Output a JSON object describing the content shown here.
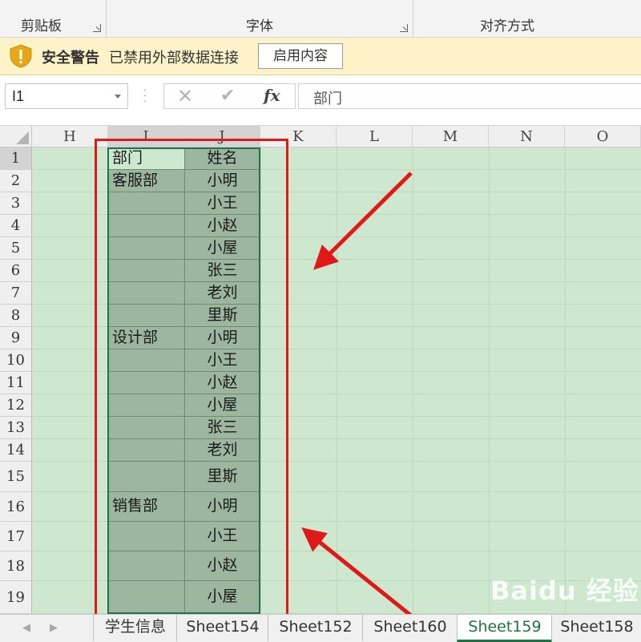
{
  "ribbon": {
    "groups": [
      {
        "label": "剪贴板"
      },
      {
        "label": "字体"
      },
      {
        "label": "对齐方式"
      }
    ]
  },
  "security_bar": {
    "title": "安全警告",
    "message": "已禁用外部数据连接",
    "enable_button": "启用内容"
  },
  "formula_bar": {
    "name_box": "I1",
    "formula": "部门",
    "fx_label": "fx"
  },
  "columns": [
    "H",
    "I",
    "J",
    "K",
    "L",
    "M",
    "N",
    "O"
  ],
  "rows": [
    "1",
    "2",
    "3",
    "4",
    "5",
    "6",
    "7",
    "8",
    "9",
    "10",
    "11",
    "12",
    "13",
    "14",
    "15",
    "16",
    "17",
    "18",
    "19"
  ],
  "data": {
    "I": [
      "部门",
      "客服部",
      "",
      "",
      "",
      "",
      "",
      "",
      "设计部",
      "",
      "",
      "",
      "",
      "",
      "",
      "销售部",
      "",
      "",
      ""
    ],
    "J": [
      "姓名",
      "小明",
      "小王",
      "小赵",
      "小屋",
      "张三",
      "老刘",
      "里斯",
      "小明",
      "小王",
      "小赵",
      "小屋",
      "张三",
      "老刘",
      "里斯",
      "小明",
      "小王",
      "小赵",
      "小屋"
    ]
  },
  "sheet_tabs": [
    "学生信息",
    "Sheet154",
    "Sheet152",
    "Sheet160",
    "Sheet159",
    "Sheet158"
  ],
  "active_tab": "Sheet159",
  "watermark": "Baidu 经验",
  "colors": {
    "sheet_fill": "#cde8ce",
    "selection_fill": "#9db69f",
    "accent": "#217346",
    "annotation": "#e01818",
    "warning_bar": "#fdf2c8"
  }
}
